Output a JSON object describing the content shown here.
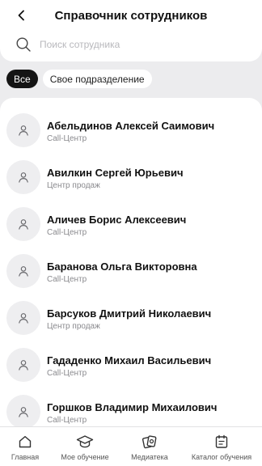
{
  "header": {
    "title": "Справочник сотрудников",
    "search_placeholder": "Поиск сотрудника",
    "search_value": ""
  },
  "filters": [
    {
      "label": "Все",
      "active": true
    },
    {
      "label": "Свое подразделение",
      "active": false
    }
  ],
  "employees": [
    {
      "name": "Абельдинов Алексей Саимович",
      "department": "Call-Центр"
    },
    {
      "name": "Авилкин Сергей Юрьевич",
      "department": "Центр продаж"
    },
    {
      "name": "Аличев Борис Алексеевич",
      "department": "Call-Центр"
    },
    {
      "name": "Баранова Ольга Викторовна",
      "department": "Call-Центр"
    },
    {
      "name": "Барсуков Дмитрий Николаевич",
      "department": "Центр продаж"
    },
    {
      "name": "Гададенко Михаил Васильевич",
      "department": "Call-Центр"
    },
    {
      "name": "Горшков Владимир Михаилович",
      "department": "Call-Центр"
    }
  ],
  "tabbar": {
    "items": [
      {
        "label": "Главная",
        "icon": "home-icon"
      },
      {
        "label": "Мое обучение",
        "icon": "graduation-cap-icon"
      },
      {
        "label": "Медиатека",
        "icon": "media-library-icon"
      },
      {
        "label": "Каталог обучения",
        "icon": "catalog-icon"
      }
    ]
  },
  "colors": {
    "background": "#ececee",
    "surface": "#ffffff",
    "chip_active": "#141414",
    "secondary_text": "#8a8a8e"
  }
}
